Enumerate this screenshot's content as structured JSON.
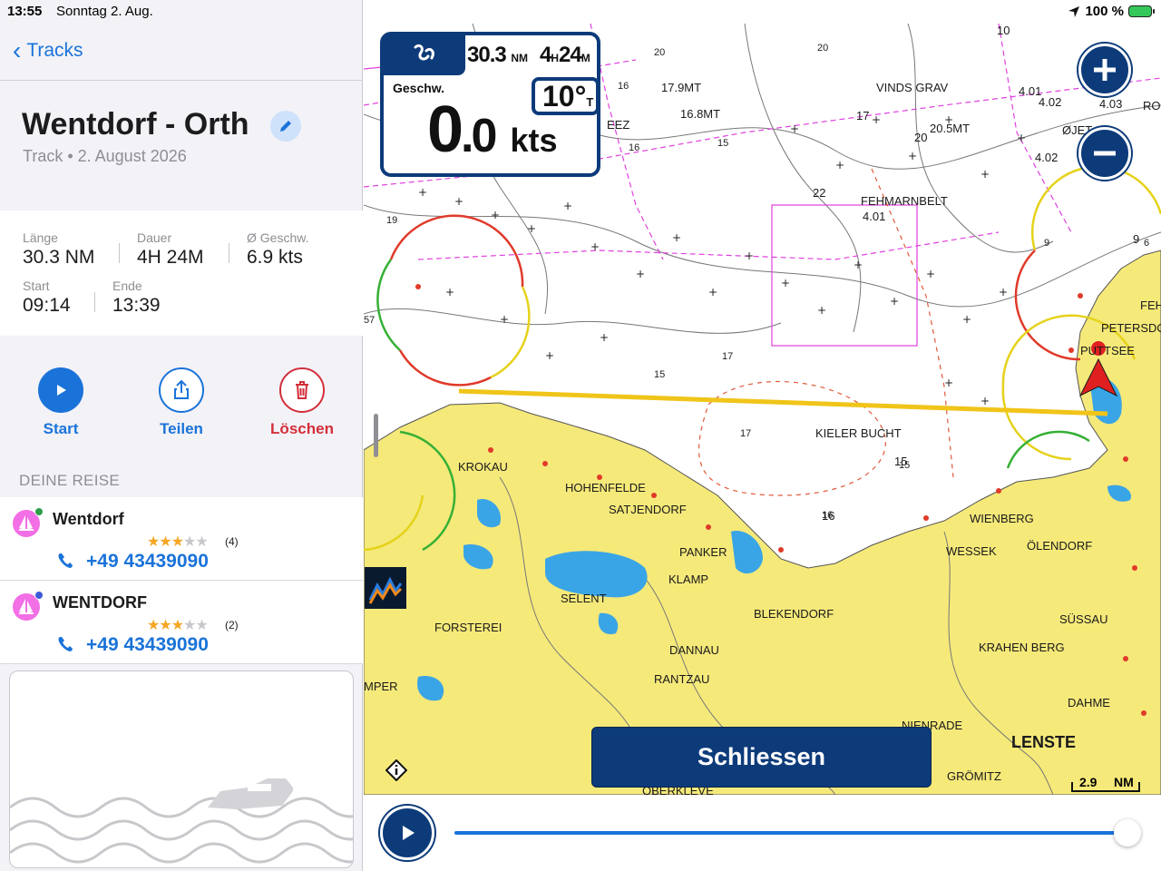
{
  "status": {
    "time": "13:55",
    "date": "Sonntag 2. Aug.",
    "battery": "100 %"
  },
  "nav": {
    "back_label": "Tracks"
  },
  "track": {
    "title": "Wentdorf - Orth",
    "subtitle": "Track • 2. August 2026"
  },
  "stats": {
    "length_label": "Länge",
    "length_value": "30.3 NM",
    "duration_label": "Dauer",
    "duration_value": "4H 24M",
    "avg_speed_label": "Ø Geschw.",
    "avg_speed_value": "6.9 kts",
    "start_label": "Start",
    "start_value": "09:14",
    "end_label": "Ende",
    "end_value": "13:39"
  },
  "actions": {
    "start": "Start",
    "share": "Teilen",
    "delete": "Löschen"
  },
  "section": {
    "title": "DEINE REISE"
  },
  "places": [
    {
      "name": "Wentdorf",
      "rating": 3,
      "reviews": "(4)",
      "phone": "+49 43439090",
      "badge_color": "#2e9e48"
    },
    {
      "name": "WENTDORF",
      "rating": 3,
      "reviews": "(2)",
      "phone": "+49 43439090",
      "badge_color": "#3b5bd6"
    }
  ],
  "overlay": {
    "distance": "30.3",
    "distance_unit": "NM",
    "duration_h": "4",
    "duration_h_unit": "H",
    "duration_m": "24",
    "duration_m_unit": "M",
    "speed_label": "Geschw.",
    "speed_int": "0",
    "speed_dec": ".0",
    "speed_unit": "kts",
    "heading": "10°",
    "heading_ref": "T"
  },
  "map": {
    "labels": {
      "fehmarnbelt": "FEHMARNBELT",
      "kieler_bucht": "KIELER BUCHT",
      "krokau": "KROKAU",
      "hohenfelde": "HOHENFELDE",
      "satjendorf": "SATJENDORF",
      "panker": "PANKER",
      "klamp": "KLAMP",
      "selent": "SELENT",
      "blekendorf": "BLEKENDORF",
      "forsterei": "FORSTEREI",
      "dannau": "DANNAU",
      "rantzau": "RANTZAU",
      "wienberg": "WIENBERG",
      "wessek": "WESSEK",
      "oelendorf": "ÖLENDORF",
      "suessau": "SÜSSAU",
      "krahenberg": "KRAHEN BERG",
      "dahme": "DAHME",
      "lenste": "LENSTE",
      "groemitz": "GRÖMITZ",
      "vinds_grav": "VINDS GRAV",
      "petersdorf": "PETERSDO",
      "puttsee": "PUTTSEE",
      "fehm": "FEH",
      "mper": "MPER",
      "nienrade": "NIENRADE",
      "oberkleve": "OBERKLEVE",
      "ro": "RO",
      "oejet": "ØJET",
      "eez": "EEZ",
      "d_17_9": "17.9MT",
      "d_16_8": "16.8MT",
      "d_20_5": "20.5MT",
      "d_4_01": "4.01",
      "d_4_02": "4.02",
      "d_4_03": "4.03",
      "d_4_01b": "4.01",
      "d_4_02b": "4.02",
      "d_10": "10",
      "d_9": "9",
      "d_17": "17",
      "d_20": "20",
      "d_16": "16",
      "d_15": "15",
      "d_22": "22"
    },
    "scale_value": "2.9",
    "scale_unit": "NM"
  },
  "buttons": {
    "close": "Schliessen"
  },
  "colors": {
    "accent": "#1a73d9",
    "navy": "#0d3b7a",
    "delete": "#d32f3a",
    "land": "#f5e97a",
    "water": "#ffffff",
    "lake": "#3aa5e6",
    "track": "#f0c419"
  }
}
